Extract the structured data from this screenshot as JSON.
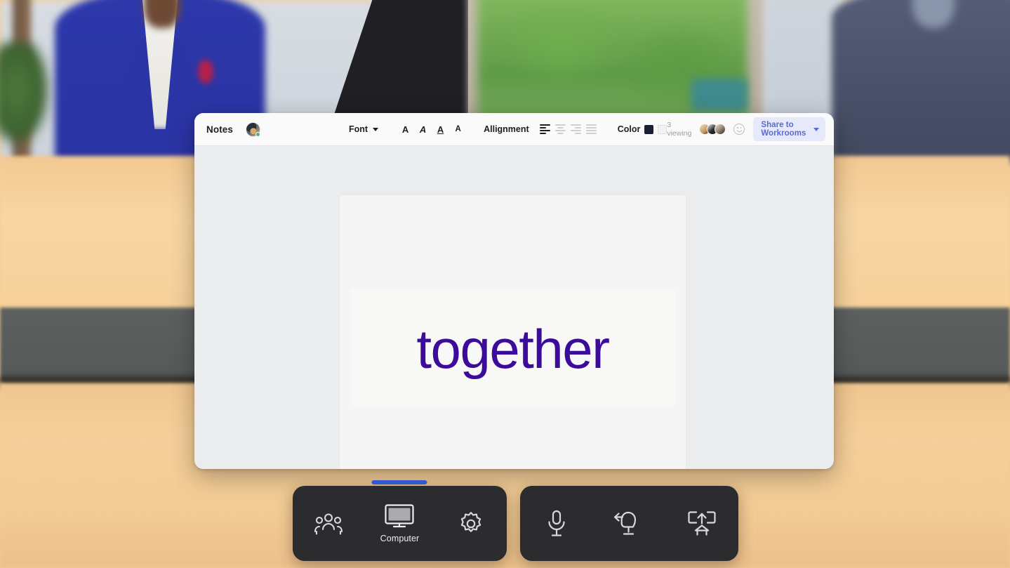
{
  "scene": {
    "description": "Blurred VR meeting room with wooden desk",
    "desk_color": "#f5ce94",
    "desk_band_color": "#5a5f5e"
  },
  "app": {
    "title": "Notes",
    "window_bg": "#ebecee",
    "toolbar_bg": "#fafafa"
  },
  "toolbar": {
    "title": "Notes",
    "avatar": {
      "name": "document-owner-avatar",
      "status": "online",
      "status_color": "#45bd62"
    },
    "font": {
      "label": "Font",
      "caret": "chevron-down-icon",
      "styles": [
        {
          "name": "bold",
          "glyph": "A"
        },
        {
          "name": "italic",
          "glyph": "A"
        },
        {
          "name": "underline",
          "glyph": "A"
        },
        {
          "name": "small",
          "glyph": "A"
        }
      ]
    },
    "alignment": {
      "label": "Allignment",
      "options": [
        "align-left",
        "align-center",
        "align-right",
        "align-justify"
      ],
      "active": "align-left"
    },
    "color": {
      "label": "Color",
      "swatches": [
        "#1c1f33",
        "#f2f2f3"
      ],
      "active": "#1c1f33"
    },
    "viewing": "3 viewing",
    "viewers_count": 3,
    "emoji_button": "smiley-face-icon",
    "share": {
      "label": "Share to Workrooms",
      "text_color": "#5b6ad0",
      "bg_color": "#e6e9f9",
      "caret": "chevron-down-icon"
    }
  },
  "document": {
    "text": "together",
    "text_color": "#3d0b9b",
    "page_bg": "#f5f5f6",
    "selection_bg": "#f8f8f6",
    "add_button": "add-icon"
  },
  "dock_left": {
    "items": [
      {
        "name": "people",
        "icon": "people-group-icon",
        "label": "",
        "active": false
      },
      {
        "name": "computer",
        "icon": "monitor-icon",
        "label": "Computer",
        "active": true
      },
      {
        "name": "settings",
        "icon": "gear-icon",
        "label": "",
        "active": false
      }
    ],
    "indicator_color": "#3059d0",
    "bg": "#2c2c2e"
  },
  "dock_right": {
    "items": [
      {
        "name": "microphone",
        "icon": "microphone-icon"
      },
      {
        "name": "return-to-seat",
        "icon": "chair-back-arrow-icon"
      },
      {
        "name": "share-desk",
        "icon": "desk-screen-share-icon"
      }
    ],
    "bg": "#2c2c2e"
  }
}
